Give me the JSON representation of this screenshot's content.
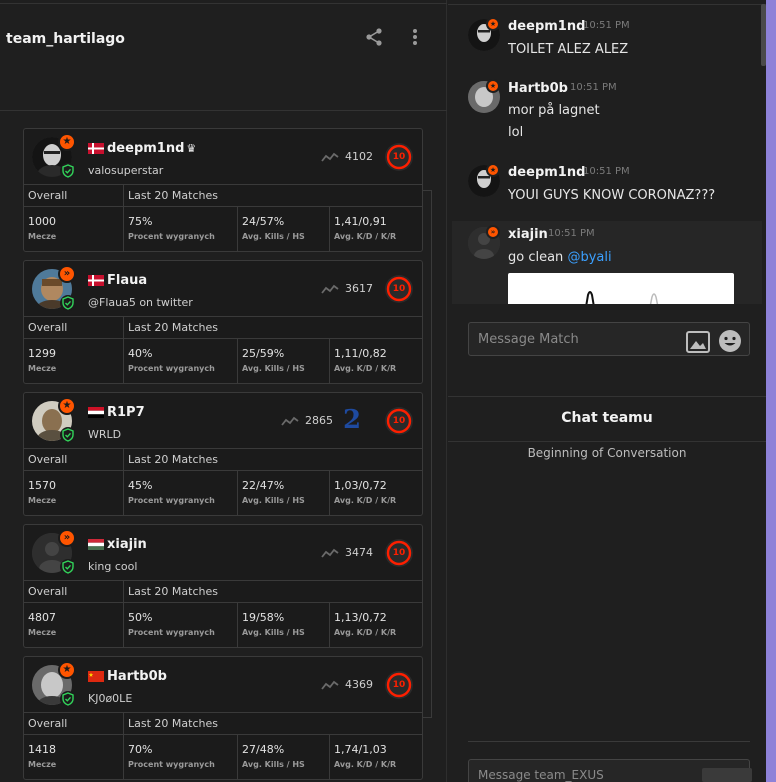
{
  "team": {
    "name": "team_hartilago"
  },
  "table_headers": {
    "overall": "Overall",
    "last20": "Last 20 Matches"
  },
  "players": [
    {
      "name": "deepm1nd",
      "sub": "valosuperstar",
      "elo": "4102",
      "level": "10",
      "flag": "Denmark",
      "crown": "♛",
      "stats": {
        "matches": "1000",
        "matches_label": "Mecze",
        "winrate": "75%",
        "winrate_label": "Procent wygranych",
        "kills": "24/57%",
        "kills_label": "Avg. Kills / HS",
        "kd": "1,41/0,91",
        "kd_label": "Avg. K/D / K/R"
      }
    },
    {
      "name": "Flaua",
      "sub": "@Flaua5 on twitter",
      "elo": "3617",
      "level": "10",
      "flag": "Denmark",
      "stats": {
        "matches": "1299",
        "matches_label": "Mecze",
        "winrate": "40%",
        "winrate_label": "Procent wygranych",
        "kills": "25/59%",
        "kills_label": "Avg. Kills / HS",
        "kd": "1,11/0,82",
        "kd_label": "Avg. K/D / K/R"
      }
    },
    {
      "name": "R1P7",
      "sub": "WRLD",
      "elo": "2865",
      "level": "10",
      "level_alt": "2",
      "flag": "Egypt",
      "stats": {
        "matches": "1570",
        "matches_label": "Mecze",
        "winrate": "45%",
        "winrate_label": "Procent wygranych",
        "kills": "22/47%",
        "kills_label": "Avg. Kills / HS",
        "kd": "1,03/0,72",
        "kd_label": "Avg. K/D / K/R"
      }
    },
    {
      "name": "xiajin",
      "sub": "king cool",
      "elo": "3474",
      "level": "10",
      "flag": "Hungary",
      "stats": {
        "matches": "4807",
        "matches_label": "Mecze",
        "winrate": "50%",
        "winrate_label": "Procent wygranych",
        "kills": "19/58%",
        "kills_label": "Avg. Kills / HS",
        "kd": "1,13/0,72",
        "kd_label": "Avg. K/D / K/R"
      }
    },
    {
      "name": "Hartb0b",
      "sub": "KJ0ø0LE",
      "elo": "4369",
      "level": "10",
      "flag": "China",
      "stats": {
        "matches": "1418",
        "matches_label": "Mecze",
        "winrate": "70%",
        "winrate_label": "Procent wygranych",
        "kills": "27/48%",
        "kills_label": "Avg. Kills / HS",
        "kd": "1,74/1,03",
        "kd_label": "Avg. K/D / K/R"
      }
    }
  ],
  "chat": {
    "messages": [
      {
        "author": "deepm1nd",
        "time": "10:51 PM",
        "lines": [
          "TOILET ALEZ ALEZ"
        ]
      },
      {
        "author": "Hartb0b",
        "time": "10:51 PM",
        "lines": [
          "mor på lagnet",
          "lol"
        ]
      },
      {
        "author": "deepm1nd",
        "time": "10:51 PM",
        "lines": [
          "YOUI GUYS KNOW CORONAZ???"
        ]
      },
      {
        "author": "xiajin",
        "time": "10:51 PM",
        "text_prefix": "go clean ",
        "mention": "@byali"
      }
    ],
    "input_placeholder": "Message Match"
  },
  "team_chat": {
    "title": "Chat teamu",
    "empty_text": "Beginning of Conversation",
    "input_placeholder": "Message team_EXUS"
  },
  "colors": {
    "accent": "#ff5500",
    "level": "#fe1f00",
    "mention": "#3ba0ff",
    "purple_strip": "#8e82d8"
  }
}
